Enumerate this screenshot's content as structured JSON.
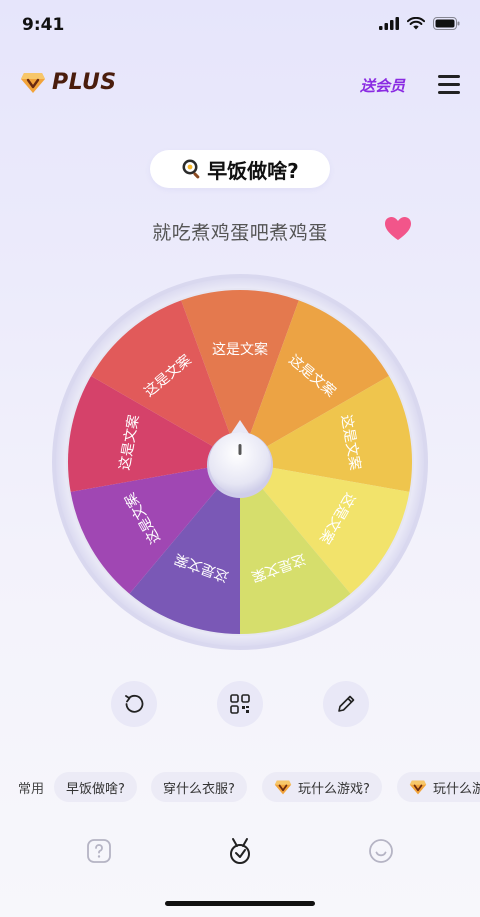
{
  "status": {
    "time": "9:41"
  },
  "header": {
    "brand": "PLUS",
    "gift_vip": "送会员"
  },
  "question": {
    "text": "早饭做啥?"
  },
  "result": {
    "text": "就吃煮鸡蛋吧煮鸡蛋"
  },
  "wheel": {
    "slices": [
      {
        "label": "这是文案",
        "color": "#e4794e"
      },
      {
        "label": "这是文案",
        "color": "#eca344"
      },
      {
        "label": "这是文案",
        "color": "#efc54d"
      },
      {
        "label": "这是文案",
        "color": "#f2e36b"
      },
      {
        "label": "这是文案",
        "color": "#d6de6c"
      },
      {
        "label": "这是文案",
        "color": "#7a58b6"
      },
      {
        "label": "这是文案",
        "color": "#a047b3"
      },
      {
        "label": "这是文案",
        "color": "#d5426a"
      },
      {
        "label": "这是文案",
        "color": "#e15a5a"
      }
    ]
  },
  "toolbar": {
    "reset_icon": "rotate-ccw-icon",
    "qr_icon": "qr-code-icon",
    "edit_icon": "pencil-icon"
  },
  "presets": {
    "label": "常用",
    "chips": [
      {
        "text": "早饭做啥?",
        "vip": false
      },
      {
        "text": "穿什么衣服?",
        "vip": false
      },
      {
        "text": "玩什么游戏?",
        "vip": true
      },
      {
        "text": "玩什么游",
        "vip": true
      }
    ]
  },
  "tabbar": {
    "tabs": [
      {
        "icon": "help-icon"
      },
      {
        "icon": "medal-icon"
      },
      {
        "icon": "smile-icon"
      }
    ]
  },
  "colors": {
    "accent": "#8a2be2",
    "heart": "#f2558a",
    "brand": "#4a1d0c"
  }
}
